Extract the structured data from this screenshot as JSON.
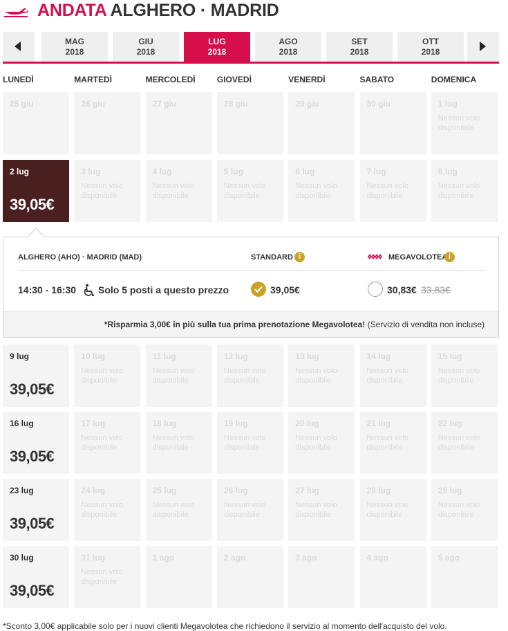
{
  "header": {
    "direction": "ANDATA",
    "route": "ALGHERO · MADRID",
    "plane_icon": "plane-takeoff-icon",
    "accent_color": "#d60f4c"
  },
  "months": [
    {
      "month": "MAG",
      "year": "2018",
      "active": false
    },
    {
      "month": "GIU",
      "year": "2018",
      "active": false
    },
    {
      "month": "LUG",
      "year": "2018",
      "active": true
    },
    {
      "month": "AGO",
      "year": "2018",
      "active": false
    },
    {
      "month": "SET",
      "year": "2018",
      "active": false
    },
    {
      "month": "OTT",
      "year": "2018",
      "active": false
    }
  ],
  "weekdays": [
    "LUNEDÌ",
    "MARTEDÌ",
    "MERCOLEDÌ",
    "GIOVEDÌ",
    "VENERDÌ",
    "SABATO",
    "DOMENICA"
  ],
  "no_flight_text": "Nessun volo disponibile",
  "weeks": [
    [
      {
        "date": "25 giu",
        "status": "out"
      },
      {
        "date": "26 giu",
        "status": "out"
      },
      {
        "date": "27 giu",
        "status": "out"
      },
      {
        "date": "28 giu",
        "status": "out"
      },
      {
        "date": "29 giu",
        "status": "out"
      },
      {
        "date": "30 giu",
        "status": "out"
      },
      {
        "date": "1 lug",
        "status": "none"
      }
    ],
    [
      {
        "date": "2 lug",
        "status": "selected",
        "price": "39,05€"
      },
      {
        "date": "3 lug",
        "status": "none"
      },
      {
        "date": "4 lug",
        "status": "none"
      },
      {
        "date": "5 lug",
        "status": "none"
      },
      {
        "date": "6 lug",
        "status": "none"
      },
      {
        "date": "7 lug",
        "status": "none"
      },
      {
        "date": "8 lug",
        "status": "none"
      }
    ],
    [
      {
        "date": "9 lug",
        "status": "avail",
        "price": "39,05€"
      },
      {
        "date": "10 lug",
        "status": "none"
      },
      {
        "date": "11 lug",
        "status": "none"
      },
      {
        "date": "12 lug",
        "status": "none"
      },
      {
        "date": "13 lug",
        "status": "none"
      },
      {
        "date": "14 lug",
        "status": "none"
      },
      {
        "date": "15 lug",
        "status": "none"
      }
    ],
    [
      {
        "date": "16 lug",
        "status": "avail",
        "price": "39,05€"
      },
      {
        "date": "17 lug",
        "status": "none"
      },
      {
        "date": "18 lug",
        "status": "none"
      },
      {
        "date": "19 lug",
        "status": "none"
      },
      {
        "date": "20 lug",
        "status": "none"
      },
      {
        "date": "21 lug",
        "status": "none"
      },
      {
        "date": "22 lug",
        "status": "none"
      }
    ],
    [
      {
        "date": "23 lug",
        "status": "avail",
        "price": "39,05€"
      },
      {
        "date": "24 lug",
        "status": "none"
      },
      {
        "date": "25 lug",
        "status": "none"
      },
      {
        "date": "26 lug",
        "status": "none"
      },
      {
        "date": "27 lug",
        "status": "none"
      },
      {
        "date": "28 lug",
        "status": "none"
      },
      {
        "date": "29 lug",
        "status": "none"
      }
    ],
    [
      {
        "date": "30 lug",
        "status": "avail",
        "price": "39,05€"
      },
      {
        "date": "31 lug",
        "status": "none"
      },
      {
        "date": "1 ago",
        "status": "out"
      },
      {
        "date": "2 ago",
        "status": "out"
      },
      {
        "date": "3 ago",
        "status": "out"
      },
      {
        "date": "4 ago",
        "status": "out"
      },
      {
        "date": "5 ago",
        "status": "out"
      }
    ]
  ],
  "flight_panel": {
    "route": "ALGHERO (AHO) · MADRID (MAD)",
    "standard_label": "STANDARD",
    "mega_label": "MEGAVOLOTEA",
    "info_glyph": "i",
    "times": "14:30 - 16:30",
    "seats": "Solo 5 posti a questo prezzo",
    "standard_price": "39,05€",
    "mega_price": "30,83€",
    "mega_old_price": "33,83€",
    "standard_selected": true,
    "promo_bold": "*Risparmia 3,00€ in più sulla tua prima prenotazione Megavolotea!",
    "promo_rest": " (Servizio di vendita non incluse)"
  },
  "footnote": "*Sconto 3,00€ applicabile solo per i nuovi clienti Megavolotea che richiedono il servizio al momento dell'acquisto del volo."
}
